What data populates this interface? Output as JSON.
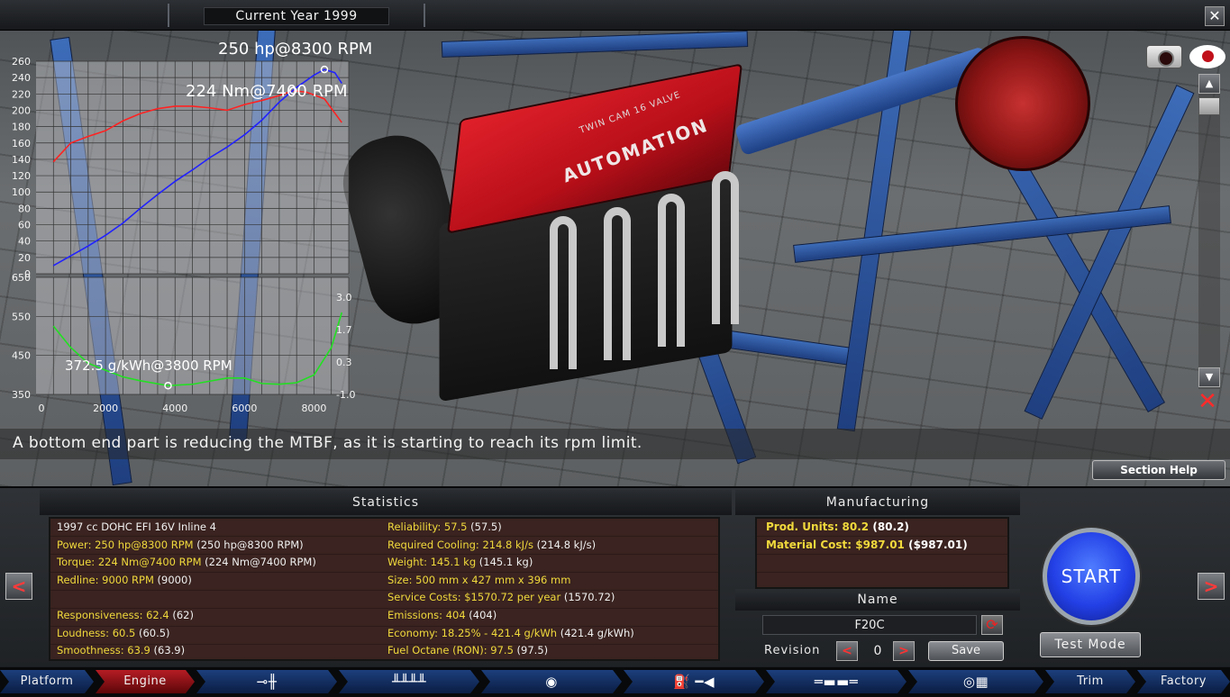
{
  "topbar": {
    "year_label": "Current Year 1999",
    "close_label": "✕"
  },
  "graphs": {
    "power_peak": "250 hp@8300 RPM",
    "torque_peak": "224 Nm@7400 RPM",
    "bsfc_min": "372.5 g/kWh@3800 RPM",
    "top_yticks": [
      "260",
      "240",
      "220",
      "200",
      "180",
      "160",
      "140",
      "120",
      "100",
      "80",
      "60",
      "40",
      "20",
      "0"
    ],
    "bottom_yticks_left": [
      "650",
      "550",
      "450",
      "350"
    ],
    "bottom_yticks_right": [
      "3.0",
      "1.7",
      "0.3",
      "-1.0"
    ],
    "xticks": [
      "0",
      "2000",
      "4000",
      "6000",
      "8000"
    ]
  },
  "chart_data": [
    {
      "type": "line",
      "xlabel": "",
      "ylabel": "",
      "xlim": [
        0,
        9000
      ],
      "ylim": [
        0,
        260
      ],
      "series": [
        {
          "name": "",
          "color": "#ff2222",
          "x": [
            500,
            1000,
            1500,
            2000,
            2500,
            3000,
            3500,
            4000,
            4500,
            5000,
            5500,
            6000,
            6500,
            7000,
            7400,
            7800,
            8300,
            8800
          ],
          "y": [
            137,
            160,
            168,
            175,
            187,
            196,
            202,
            205,
            205,
            203,
            200,
            207,
            212,
            218,
            224,
            222,
            214,
            185
          ]
        },
        {
          "name": "",
          "color": "#2222ff",
          "x": [
            500,
            1000,
            1500,
            2000,
            2500,
            3000,
            3500,
            4000,
            4500,
            5000,
            5500,
            6000,
            6500,
            7000,
            7500,
            8000,
            8300,
            8600,
            8800
          ],
          "y": [
            10,
            22,
            34,
            47,
            62,
            80,
            97,
            113,
            127,
            142,
            155,
            170,
            188,
            210,
            228,
            243,
            250,
            246,
            233
          ]
        }
      ]
    },
    {
      "type": "line",
      "xlabel": "",
      "ylabel": "",
      "xlim": [
        0,
        9000
      ],
      "ylim": [
        350,
        650
      ],
      "series": [
        {
          "name": "",
          "color": "#22e022",
          "x": [
            500,
            1000,
            1500,
            2000,
            2500,
            3000,
            3800,
            4500,
            5000,
            5500,
            6000,
            6500,
            7000,
            7500,
            8000,
            8500,
            8800
          ],
          "y": [
            525,
            470,
            430,
            412,
            395,
            385,
            372.5,
            376,
            384,
            392,
            392,
            378,
            376,
            380,
            400,
            470,
            560
          ]
        }
      ]
    }
  ],
  "help_text": "A bottom end part is reducing the MTBF, as it is starting to reach its rpm limit.",
  "section_help_label": "Section Help",
  "engine_brand": "AUTOMATION",
  "engine_cam_label": "TWIN CAM 16 VALVE",
  "statistics": {
    "title": "Statistics",
    "left": [
      {
        "key": "desc",
        "w": "1997 cc DOHC EFI 16V Inline 4"
      },
      {
        "key": "power",
        "y": "Power: 250 hp@8300 RPM",
        "w": " (250 hp@8300 RPM)"
      },
      {
        "key": "torque",
        "y": "Torque: 224 Nm@7400 RPM",
        "w": " (224 Nm@7400 RPM)"
      },
      {
        "key": "redline",
        "y": "Redline: 9000 RPM",
        "w": " (9000)"
      },
      {
        "key": "blank",
        "w": ""
      },
      {
        "key": "responsiveness",
        "y": "Responsiveness: 62.4",
        "w": " (62)"
      },
      {
        "key": "loudness",
        "y": "Loudness: 60.5",
        "w": " (60.5)"
      },
      {
        "key": "smoothness",
        "y": "Smoothness: 63.9",
        "w": " (63.9)"
      }
    ],
    "right": [
      {
        "key": "reliability",
        "y": "Reliability: 57.5",
        "w": " (57.5)"
      },
      {
        "key": "cooling",
        "y": "Required Cooling: 214.8 kJ/s",
        "w": " (214.8 kJ/s)"
      },
      {
        "key": "weight",
        "y": "Weight: 145.1 kg",
        "w": " (145.1 kg)"
      },
      {
        "key": "size",
        "y": "Size: 500 mm x 427 mm x 396 mm",
        "w": ""
      },
      {
        "key": "service",
        "y": "Service Costs: $1570.72 per year",
        "w": " (1570.72)"
      },
      {
        "key": "emissions",
        "y": "Emissions: 404",
        "w": " (404)"
      },
      {
        "key": "economy",
        "y": "Economy: 18.25% - 421.4 g/kWh",
        "w": " (421.4 g/kWh)"
      },
      {
        "key": "octane",
        "y": "Fuel Octane (RON): 97.5",
        "w": " (97.5)"
      }
    ]
  },
  "manufacturing": {
    "title": "Manufacturing",
    "prod_units": "Prod. Units: 80.2",
    "prod_units_paren": " (80.2)",
    "material_cost": "Material Cost: $987.01",
    "material_cost_paren": " ($987.01)"
  },
  "name_section": {
    "title": "Name",
    "name_value": "F20C",
    "revision_label": "Revision",
    "revision_value": "0",
    "save_label": "Save"
  },
  "start_label": "START",
  "test_mode_label": "Test Mode",
  "nav": {
    "platform": "Platform",
    "engine": "Engine",
    "trim": "Trim",
    "factory": "Factory"
  }
}
